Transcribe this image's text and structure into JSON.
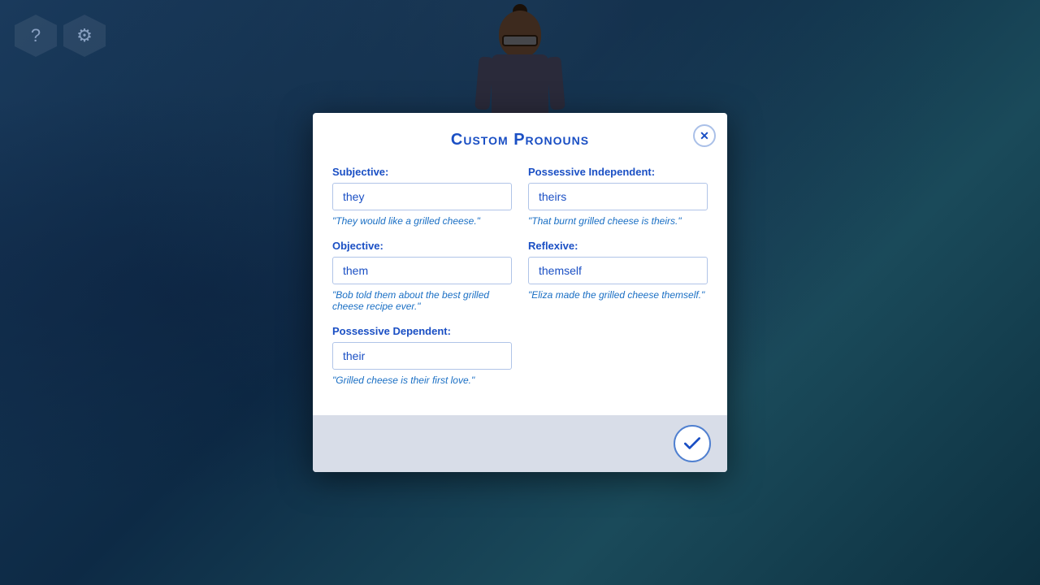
{
  "background": {
    "color": "#0d2a45"
  },
  "hex_icons": [
    {
      "icon": "?",
      "label": "help-icon"
    },
    {
      "icon": "⚙",
      "label": "settings-icon"
    }
  ],
  "modal": {
    "title": "Custom Pronouns",
    "close_label": "✕",
    "fields": {
      "subjective": {
        "label": "Subjective:",
        "value": "they",
        "example": "\"They would like a grilled cheese.\""
      },
      "possessive_independent": {
        "label": "Possessive Independent:",
        "value": "theirs",
        "example": "\"That burnt grilled cheese is theirs.\""
      },
      "objective": {
        "label": "Objective:",
        "value": "them",
        "example": "\"Bob told them about the best grilled cheese recipe ever.\""
      },
      "reflexive": {
        "label": "Reflexive:",
        "value": "themself",
        "example": "\"Eliza made the grilled cheese themself.\""
      },
      "possessive_dependent": {
        "label": "Possessive Dependent:",
        "value": "their",
        "example": "\"Grilled cheese is their first love.\""
      }
    },
    "confirm_label": "✓"
  }
}
